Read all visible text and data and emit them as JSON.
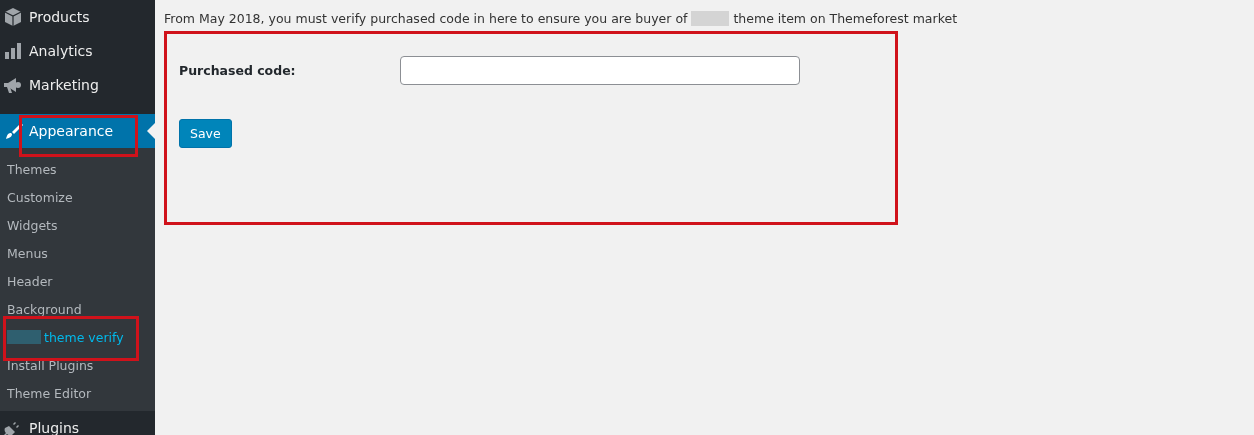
{
  "sidebar": {
    "menu_before": [
      {
        "label": "Products",
        "selected": false
      },
      {
        "label": "Analytics",
        "selected": false
      },
      {
        "label": "Marketing",
        "selected": false
      },
      {
        "label": "Appearance",
        "selected": true
      }
    ],
    "submenu": [
      {
        "label": "Themes",
        "selected": false,
        "redacted": false
      },
      {
        "label": "Customize",
        "selected": false,
        "redacted": false
      },
      {
        "label": "Widgets",
        "selected": false,
        "redacted": false
      },
      {
        "label": "Menus",
        "selected": false,
        "redacted": false
      },
      {
        "label": "Header",
        "selected": false,
        "redacted": false
      },
      {
        "label": "Background",
        "selected": false,
        "redacted": false
      },
      {
        "label": "theme verify",
        "selected": true,
        "redacted": true
      },
      {
        "label": "Install Plugins",
        "selected": false,
        "redacted": false
      },
      {
        "label": "Theme Editor",
        "selected": false,
        "redacted": false
      }
    ],
    "menu_after": [
      {
        "label": "Plugins",
        "selected": false
      }
    ]
  },
  "notice": {
    "before": "From May 2018, you must verify purchased code in here to ensure you are buyer of",
    "after": "theme item on Themeforest market"
  },
  "form": {
    "label": "Purchased code:",
    "field": {
      "kind": "text"
    },
    "button": "Save"
  }
}
